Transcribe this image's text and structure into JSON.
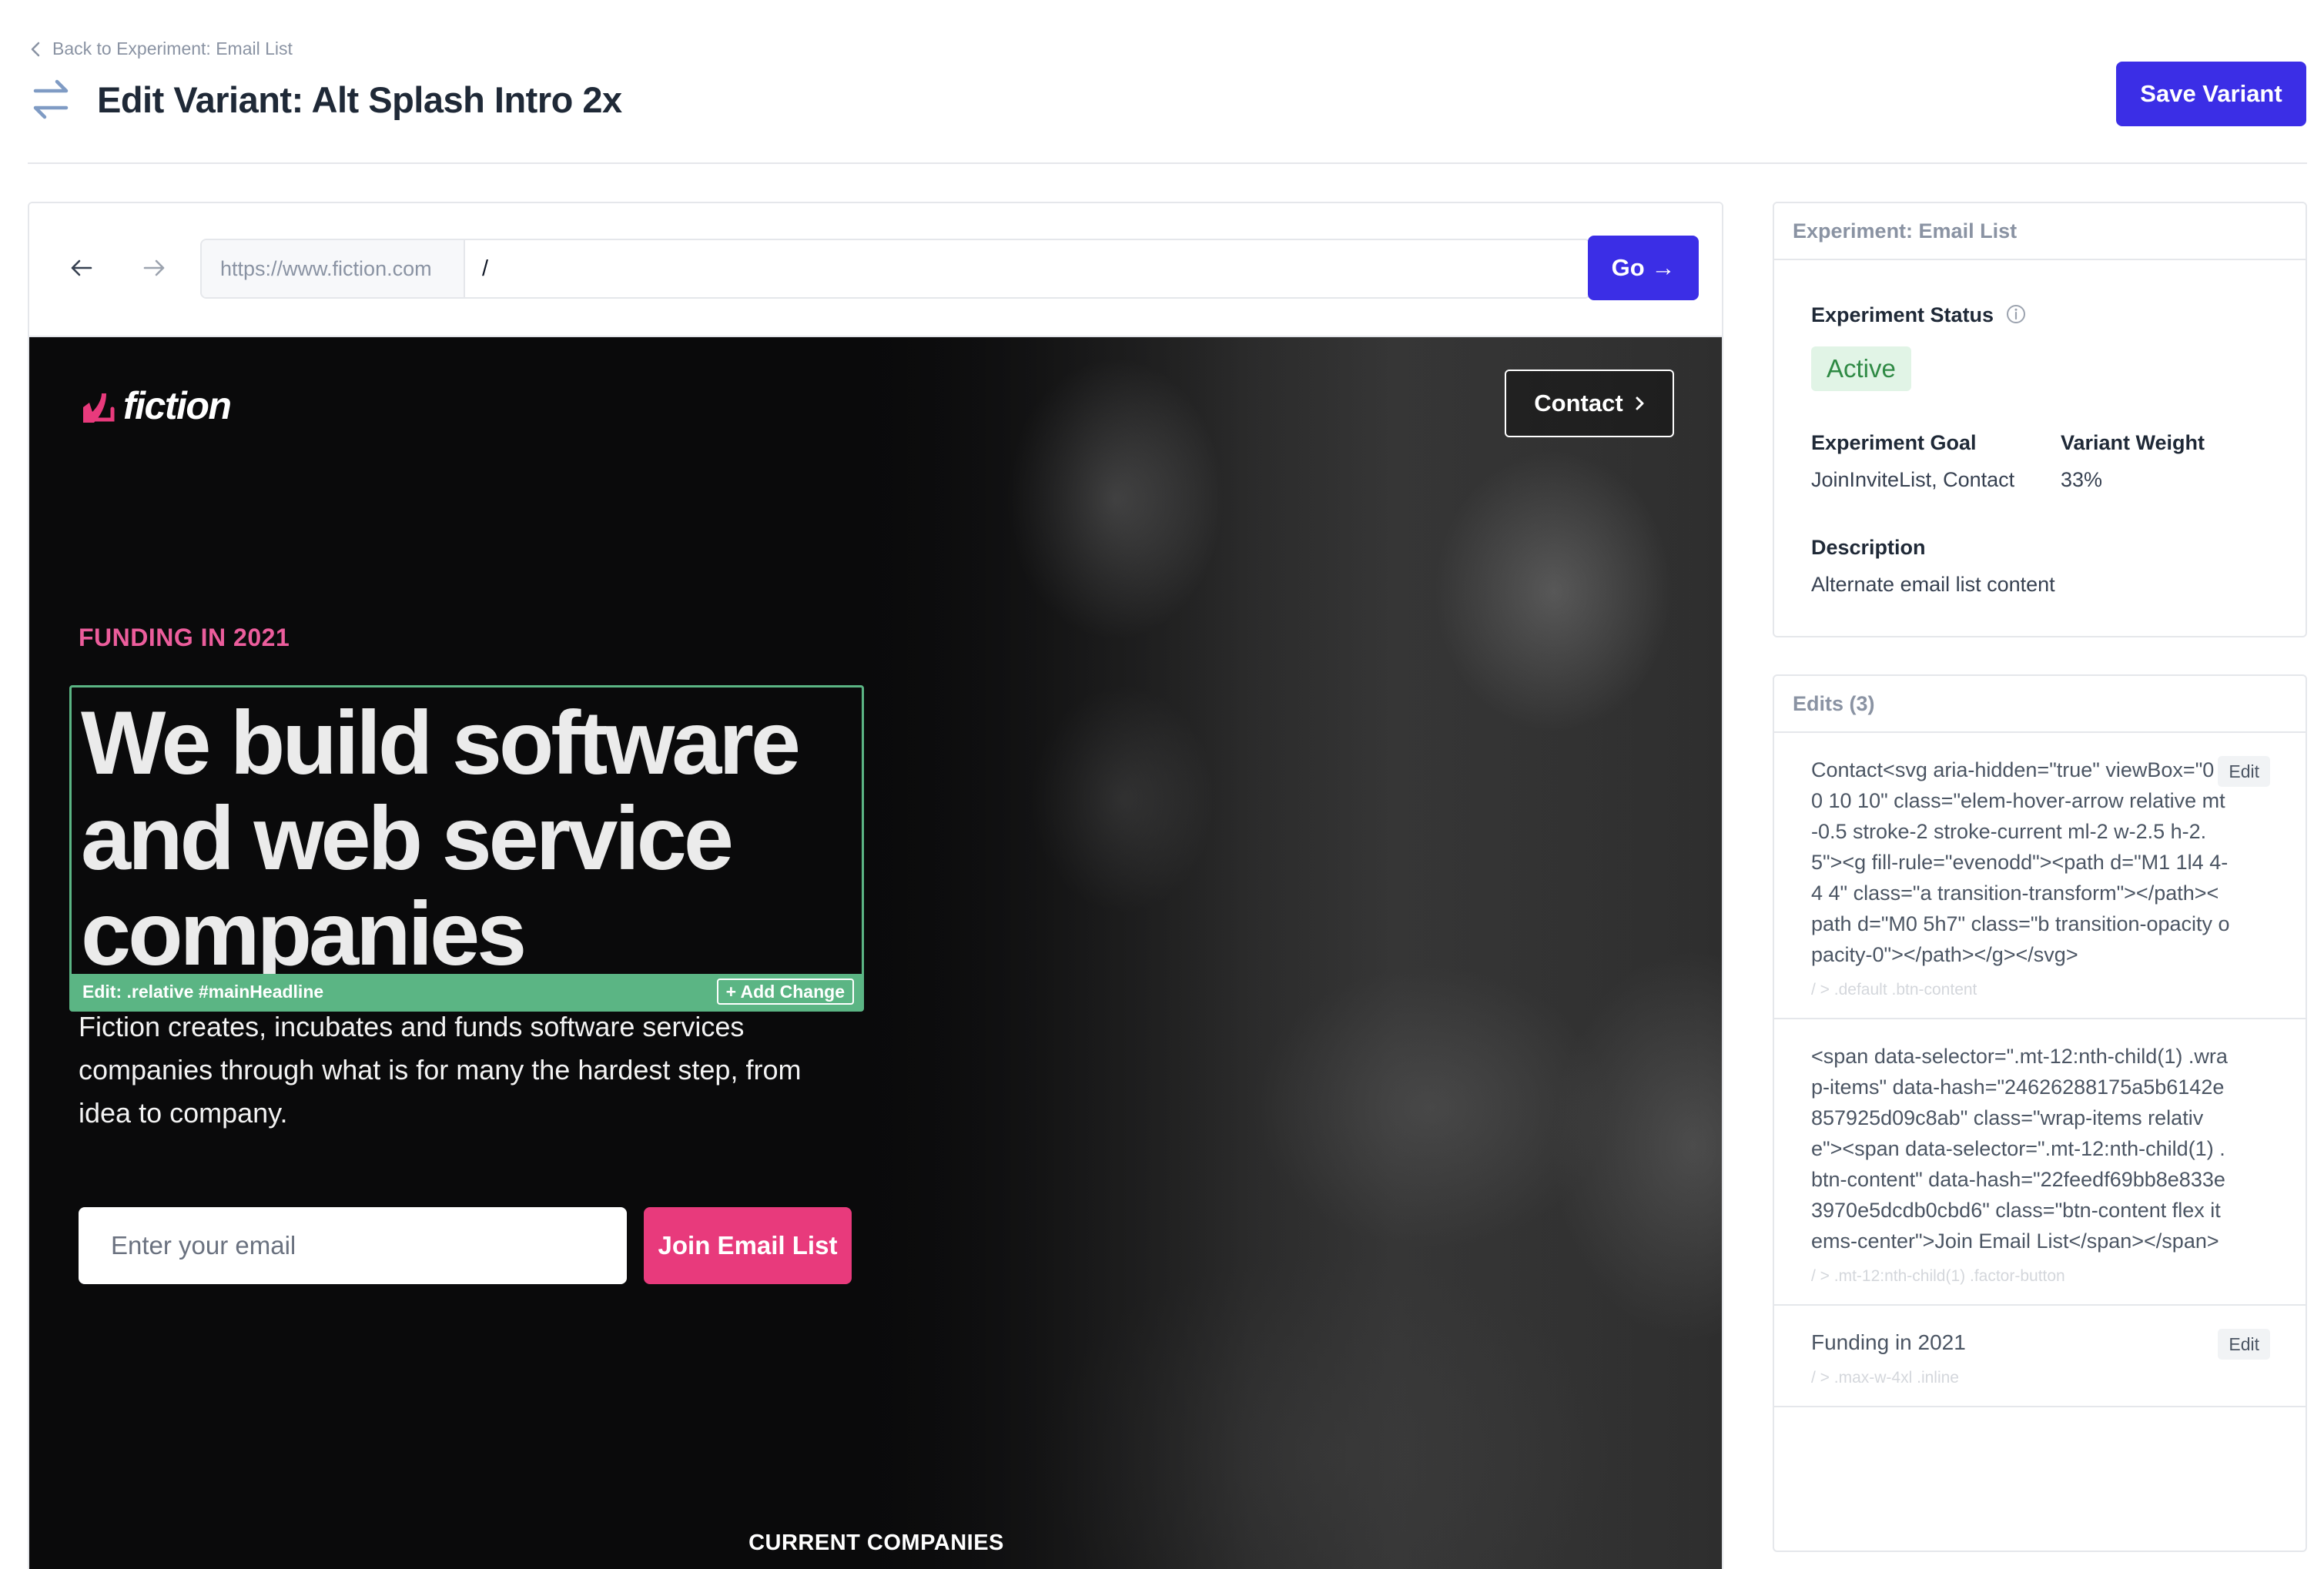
{
  "header": {
    "back_link": "Back to Experiment: Email List",
    "title": "Edit Variant: Alt Splash Intro 2x",
    "save_label": "Save Variant"
  },
  "browser": {
    "domain": "https://www.fiction.com",
    "path": "/",
    "go_label": "Go →"
  },
  "preview": {
    "logo_text": "fiction",
    "contact_label": "Contact",
    "eyebrow": "FUNDING IN 2021",
    "headline": "We build software and web service companies",
    "edit_strip_label": "Edit: .relative #mainHeadline",
    "add_change_label": "+ Add Change",
    "subtext": "Fiction creates, incubates and funds software services companies through what is for many the hardest step, from idea to company.",
    "email_placeholder": "Enter your email",
    "join_label": "Join Email List",
    "companies_label": "CURRENT COMPANIES"
  },
  "experiment": {
    "card_title": "Experiment: Email List",
    "status_label": "Experiment Status",
    "status_value": "Active",
    "goal_label": "Experiment Goal",
    "goal_value": "JoinInviteList, Contact",
    "weight_label": "Variant Weight",
    "weight_value": "33%",
    "description_label": "Description",
    "description_value": "Alternate email list content"
  },
  "edits": {
    "card_title": "Edits (3)",
    "items": [
      {
        "code": "Contact<svg aria-hidden=\"true\" viewBox=\"0 0 10 10\" class=\"elem-hover-arrow relative mt-0.5 stroke-2 stroke-current ml-2 w-2.5 h-2.5\"><g fill-rule=\"evenodd\"><path d=\"M1 1l4 4-4 4\" class=\"a transition-transform\"></path><path d=\"M0 5h7\" class=\"b transition-opacity opacity-0\"></path></g></svg>",
        "selector": "/ > .default .btn-content",
        "edit_label": "Edit"
      },
      {
        "code": "<span data-selector=\".mt-12:nth-child(1) .wrap-items\" data-hash=\"24626288175a5b6142e857925d09c8ab\" class=\"wrap-items relative\"><span data-selector=\".mt-12:nth-child(1) .btn-content\" data-hash=\"22feedf69bb8e833e3970e5dcdb0cbd6\" class=\"btn-content flex items-center\">Join Email List</span></span>",
        "selector": "/ > .mt-12:nth-child(1) .factor-button",
        "edit_label": ""
      },
      {
        "code": "Funding in 2021",
        "selector": "/ > .max-w-4xl .inline",
        "edit_label": "Edit"
      }
    ]
  },
  "colors": {
    "accent": "#3b2ee6",
    "brand_pink": "#e83a7c",
    "edit_green": "#5bb584",
    "status_green": "#2f8a45"
  },
  "icons": [
    "chevron-left-icon",
    "swap-arrows-icon",
    "arrow-left-icon",
    "arrow-right-icon",
    "fiction-logo-icon",
    "chevron-right-icon",
    "info-icon"
  ]
}
